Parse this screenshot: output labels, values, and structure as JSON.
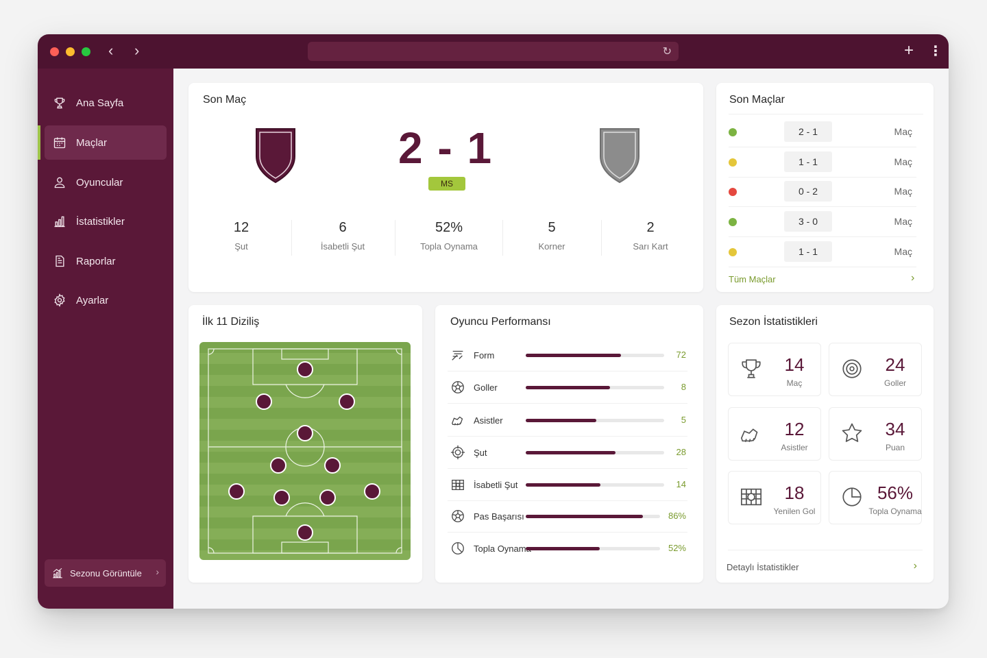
{
  "nav": {
    "back": "‹",
    "forward": "›",
    "reload": "↻",
    "new_tab": "+",
    "more": "⋮"
  },
  "sidebar": {
    "items": [
      {
        "label": "Ana Sayfa",
        "icon": "trophy-icon"
      },
      {
        "label": "Maçlar",
        "icon": "calendar-icon",
        "active": true
      },
      {
        "label": "Oyuncular",
        "icon": "user-icon"
      },
      {
        "label": "İstatistikler",
        "icon": "bar-chart-icon"
      },
      {
        "label": "Raporlar",
        "icon": "document-icon"
      },
      {
        "label": "Ayarlar",
        "icon": "gear-icon"
      }
    ],
    "season_button": "Sezonu Görüntüle",
    "season_chevron": "›"
  },
  "last_match": {
    "title": "Son Maç",
    "score": "2 - 1",
    "status": "MS",
    "stats": [
      {
        "value": "12",
        "label": "Şut"
      },
      {
        "value": "6",
        "label": "İsabetli Şut"
      },
      {
        "value": "52%",
        "label": "Topla Oynama"
      },
      {
        "value": "5",
        "label": "Korner"
      },
      {
        "value": "2",
        "label": "Sarı Kart"
      }
    ]
  },
  "recent_matches": {
    "title": "Son Maçlar",
    "rows": [
      {
        "result": "win",
        "score": "2 - 1",
        "label": "Maç"
      },
      {
        "result": "draw",
        "score": "1 - 1",
        "label": "Maç"
      },
      {
        "result": "loss",
        "score": "0 - 2",
        "label": "Maç"
      },
      {
        "result": "win",
        "score": "3 - 0",
        "label": "Maç"
      },
      {
        "result": "draw",
        "score": "1 - 1",
        "label": "Maç"
      }
    ],
    "link": "Tüm Maçlar",
    "link_chevron": "›"
  },
  "lineup": {
    "title": "İlk 11 Diziliş"
  },
  "performance": {
    "title": "Oyuncu Performansı",
    "rows": [
      {
        "label": "Form",
        "value": "72",
        "fill": 0.69,
        "icon": "form-icon"
      },
      {
        "label": "Goller",
        "value": "8",
        "fill": 0.61,
        "icon": "ball-icon"
      },
      {
        "label": "Asistler",
        "value": "5",
        "fill": 0.51,
        "icon": "boot-icon"
      },
      {
        "label": "Şut",
        "value": "28",
        "fill": 0.65,
        "icon": "target-icon"
      },
      {
        "label": "İsabetli Şut",
        "value": "14",
        "fill": 0.54,
        "icon": "goal-net-icon"
      },
      {
        "label": "Pas Başarısı",
        "value": "86%",
        "fill": 0.87,
        "icon": "ball-icon"
      },
      {
        "label": "Topla Oynama",
        "value": "52%",
        "fill": 0.55,
        "icon": "pie-icon"
      }
    ]
  },
  "season": {
    "title": "Sezon İstatistikleri",
    "stats": [
      {
        "value": "14",
        "label": "Maç",
        "icon": "trophy-icon"
      },
      {
        "value": "24",
        "label": "Goller",
        "icon": "target-icon"
      },
      {
        "value": "12",
        "label": "Asistler",
        "icon": "boot-icon"
      },
      {
        "value": "34",
        "label": "Puan",
        "icon": "star-icon"
      },
      {
        "value": "18",
        "label": "Yenilen Gol",
        "icon": "goal-net-icon"
      },
      {
        "value": "56%",
        "label": "Topla Oynama",
        "icon": "pie-icon"
      }
    ],
    "link": "Detaylı İstatistikler",
    "link_chevron": "›"
  },
  "colors": {
    "brand": "#5a1838",
    "accent": "#9fc54a",
    "win": "#7cb342",
    "draw": "#e4c63a",
    "loss": "#e5483f"
  }
}
